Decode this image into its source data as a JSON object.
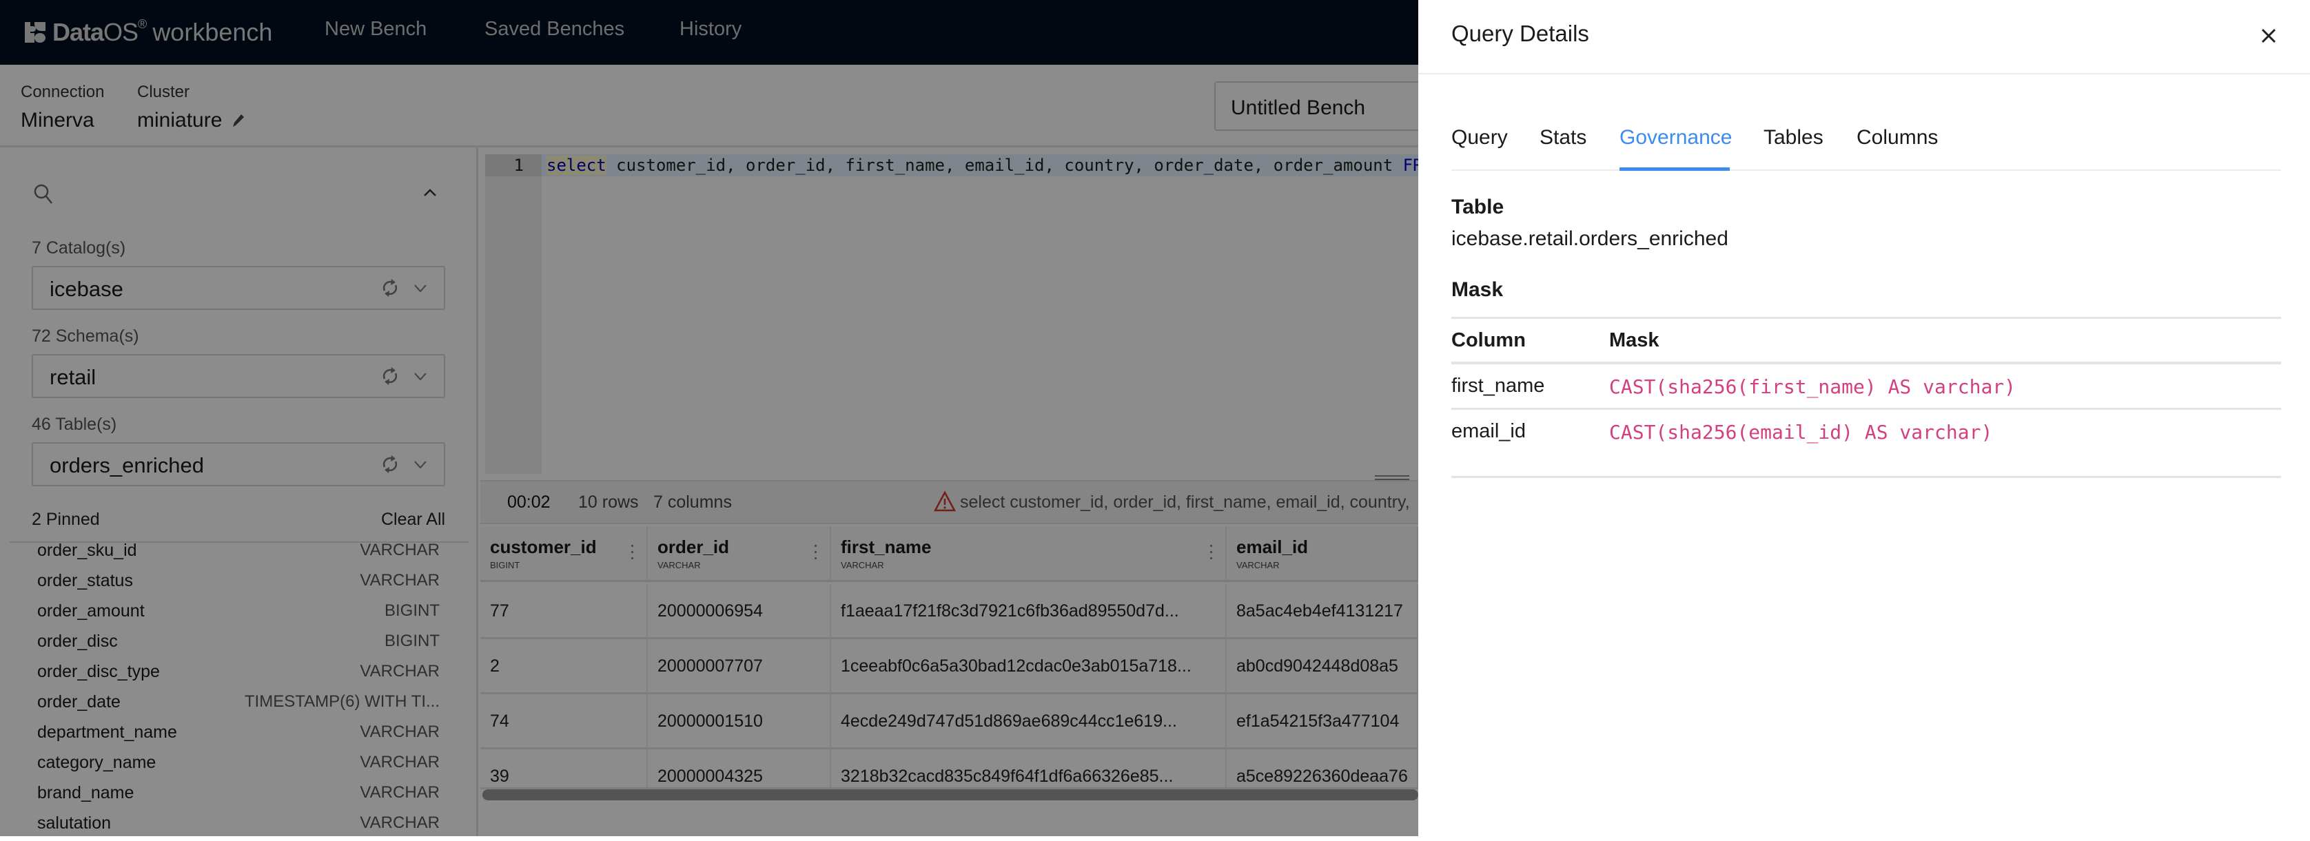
{
  "app": {
    "brand_bold": "Data",
    "brand_light": "OS",
    "brand_reg": "®",
    "brand_product": "workbench",
    "nav": [
      "New Bench",
      "Saved Benches",
      "History"
    ]
  },
  "subheader": {
    "connection_label": "Connection",
    "connection_value": "Minerva",
    "cluster_label": "Cluster",
    "cluster_value": "miniature",
    "bench_name": "Untitled Bench"
  },
  "sidebar": {
    "search_placeholder": "",
    "catalog_label": "7 Catalog(s)",
    "catalog_value": "icebase",
    "schema_label": "72 Schema(s)",
    "schema_value": "retail",
    "table_label": "46 Table(s)",
    "table_value": "orders_enriched",
    "pinned_label": "2 Pinned",
    "clear_all": "Clear All",
    "columns": [
      {
        "name": "order_sku_id",
        "type": "VARCHAR"
      },
      {
        "name": "order_status",
        "type": "VARCHAR"
      },
      {
        "name": "order_amount",
        "type": "BIGINT"
      },
      {
        "name": "order_disc",
        "type": "BIGINT"
      },
      {
        "name": "order_disc_type",
        "type": "VARCHAR"
      },
      {
        "name": "order_date",
        "type": "TIMESTAMP(6) WITH TI..."
      },
      {
        "name": "department_name",
        "type": "VARCHAR"
      },
      {
        "name": "category_name",
        "type": "VARCHAR"
      },
      {
        "name": "brand_name",
        "type": "VARCHAR"
      },
      {
        "name": "salutation",
        "type": "VARCHAR"
      }
    ]
  },
  "editor": {
    "line_number": "1",
    "keyword": "select",
    "code_rest": " customer_id, order_id, first_name, email_id, country, order_date, order_amount ",
    "keyword2": "FR"
  },
  "status": {
    "elapsed": "00:02",
    "rows": "10 rows",
    "columns": "7 columns",
    "query_preview": "select customer_id, order_id, first_name, email_id, country,"
  },
  "results": {
    "headers": [
      {
        "name": "customer_id",
        "type": "BIGINT"
      },
      {
        "name": "order_id",
        "type": "VARCHAR"
      },
      {
        "name": "first_name",
        "type": "VARCHAR"
      },
      {
        "name": "email_id",
        "type": "VARCHAR"
      }
    ],
    "rows": [
      [
        "77",
        "20000006954",
        "f1aeaa17f21f8c3d7921c6fb36ad89550d7d...",
        "8a5ac4eb4ef4131217"
      ],
      [
        "2",
        "20000007707",
        "1ceeabf0c6a5a30bad12cdac0e3ab015a718...",
        "ab0cd9042448d08a5"
      ],
      [
        "74",
        "20000001510",
        "4ecde249d747d51d869ae689c44cc1e619...",
        "ef1a54215f3a477104"
      ],
      [
        "39",
        "20000004325",
        "3218b32cacd835c849f64f1df6a66326e85...",
        "a5ce89226360deaa76"
      ]
    ]
  },
  "drawer": {
    "title": "Query Details",
    "tabs": [
      "Query",
      "Stats",
      "Governance",
      "Tables",
      "Columns"
    ],
    "active_tab": "Governance",
    "table_heading": "Table",
    "table_value": "icebase.retail.orders_enriched",
    "mask_heading": "Mask",
    "mask_columns_header": "Column",
    "mask_expr_header": "Mask",
    "masks": [
      {
        "column": "first_name",
        "expression": "CAST(sha256(first_name) AS varchar)"
      },
      {
        "column": "email_id",
        "expression": "CAST(sha256(email_id) AS varchar)"
      }
    ],
    "accent_color": "#3b8cf0",
    "mask_color": "#d43f82"
  }
}
